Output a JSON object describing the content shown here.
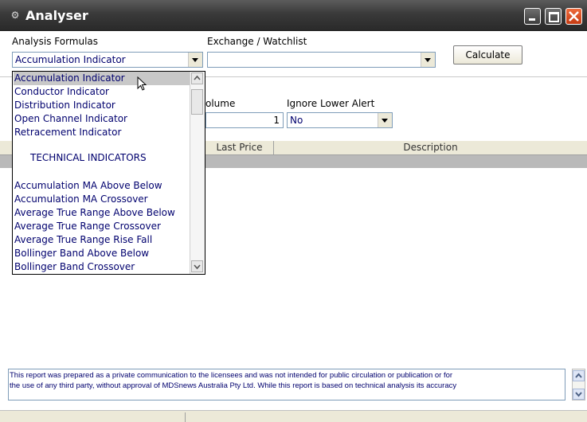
{
  "window": {
    "title": "Analyser"
  },
  "form": {
    "analysis_formulas_label": "Analysis Formulas",
    "analysis_formula_value": "Accumulation Indicator",
    "exchange_label": "Exchange / Watchlist",
    "exchange_value": "",
    "calculate_label": "Calculate",
    "volume_label": "olume",
    "volume_value": "1",
    "ignore_lower_alert_label": "Ignore Lower Alert",
    "ignore_lower_alert_value": "No"
  },
  "grid": {
    "columns": [
      "Last Price",
      "Description"
    ]
  },
  "dropdown": {
    "items": [
      "Accumulation Indicator",
      "Conductor Indicator",
      "Distribution Indicator",
      "Open Channel Indicator",
      "Retracement Indicator",
      "TECHNICAL INDICATORS",
      "Accumulation MA Above Below",
      "Accumulation MA Crossover",
      "Average True Range Above Below",
      "Average True Range Crossover",
      "Average True Range Rise Fall",
      "Bollinger Band Above Below",
      "Bollinger Band Crossover"
    ],
    "selected": "Accumulation Indicator"
  },
  "footer": {
    "disclaimer_line1": "This report was prepared as a private communication to the licensees and was not intended for public circulation or publication or for",
    "disclaimer_line2": "the use of any third party, without approval of MDSnews Australia Pty Ltd. While this report is based on technical analysis its accuracy"
  },
  "colors": {
    "link_text": "#00006e",
    "close_button": "#d8461b"
  }
}
